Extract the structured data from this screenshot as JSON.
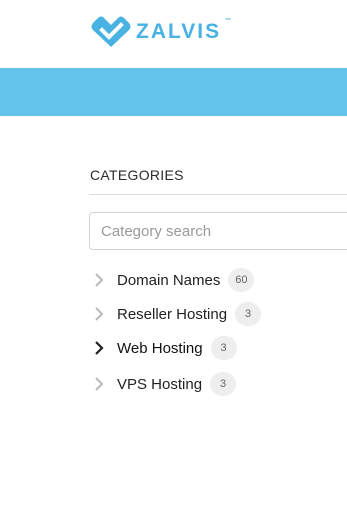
{
  "header": {
    "logo_text": "ZALVIS",
    "logo_tm": "™",
    "brand_color": "#48b2e3",
    "banner_color": "#65c4eb"
  },
  "categories": {
    "title": "CATEGORIES",
    "search_placeholder": "Category search",
    "items": [
      {
        "label": "Domain Names",
        "count": "60",
        "active": false,
        "icon": "chevron-right-icon"
      },
      {
        "label": "Reseller Hosting",
        "count": "3",
        "active": false,
        "icon": "chevron-right-icon"
      },
      {
        "label": "Web Hosting",
        "count": "3",
        "active": true,
        "icon": "chevron-right-icon"
      },
      {
        "label": "VPS Hosting",
        "count": "3",
        "active": false,
        "icon": "chevron-right-icon"
      }
    ]
  }
}
